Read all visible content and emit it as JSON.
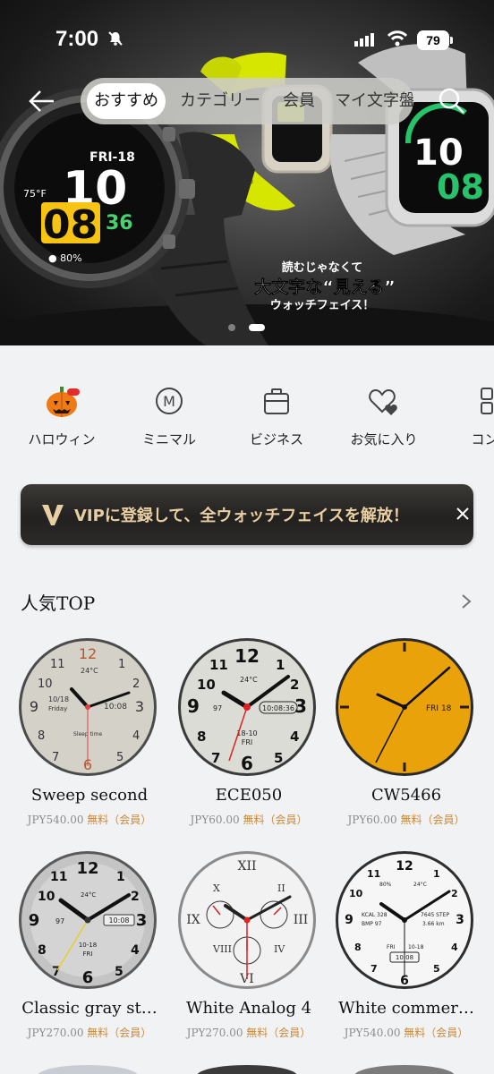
{
  "status_bar": {
    "time": "7:00",
    "battery": "79"
  },
  "nav": {
    "tabs": [
      "おすすめ",
      "カテゴリー",
      "会員",
      "マイ文字盤"
    ],
    "active_tab": "おすすめ"
  },
  "hero": {
    "line1": "読むじゃなくて",
    "line2": "大文字な“見える”",
    "line3": "ウォッチフェイス！",
    "watch_left": {
      "date": "FRI-18",
      "hour": "10",
      "minute": "08",
      "seconds": "36",
      "temp": "75°F",
      "battery": "80%"
    },
    "watch_right": {
      "hour": "10",
      "minute": "08"
    },
    "page_count": 2,
    "active_page": 2
  },
  "categories": [
    {
      "label": "ハロウィン",
      "icon": "pumpkin-icon"
    },
    {
      "label": "ミニマル",
      "icon": "minimal-m-icon"
    },
    {
      "label": "ビジネス",
      "icon": "briefcase-icon"
    },
    {
      "label": "お気に入り",
      "icon": "hearts-icon"
    },
    {
      "label": "コンポ",
      "icon": "grid-icon"
    }
  ],
  "vip_banner": {
    "text": "VIPに登録して、全ウォッチフェイスを解放！"
  },
  "section": {
    "title": "人気TOP"
  },
  "watches": [
    {
      "name": "Sweep second",
      "price": "JPY540.00",
      "free": "無料（会員）"
    },
    {
      "name": "ECE050",
      "price": "JPY60.00",
      "free": "無料（会員）"
    },
    {
      "name": "CW5466",
      "price": "JPY60.00",
      "free": "無料（会員）"
    },
    {
      "name": "Classic gray st…",
      "price": "JPY270.00",
      "free": "無料（会員）"
    },
    {
      "name": "White Analog 4",
      "price": "JPY270.00",
      "free": "無料（会員）"
    },
    {
      "name": "White commer…",
      "price": "JPY540.00",
      "free": "無料（会員）"
    }
  ],
  "watch_faces": {
    "sweep": {
      "temp": "24°C",
      "date": "10/18",
      "day": "Friday",
      "time": "10:08",
      "sleep": "Sleep time"
    },
    "ece050": {
      "temp": "24°C",
      "hr": "97",
      "time": "10:08:36",
      "date": "18-10",
      "day": "FRI"
    },
    "cw5466": {
      "date": "FRI 18"
    },
    "classic": {
      "temp": "24°C",
      "hr": "97",
      "time": "10:08",
      "date": "10-18",
      "day": "FRI"
    },
    "white_comm": {
      "battery": "80%",
      "temp": "24°C",
      "kcal": "KCAL 328",
      "bmp": "BMP 97",
      "steps": "7645 STEP",
      "km": "3.66 km",
      "day": "FRI",
      "date": "10-18",
      "time": "10:08"
    }
  },
  "colors": {
    "accent_gold": "#e8cfa3",
    "free_orange": "#c88a3e",
    "lime": "#d6e600",
    "cw_yellow": "#e9a20a"
  }
}
